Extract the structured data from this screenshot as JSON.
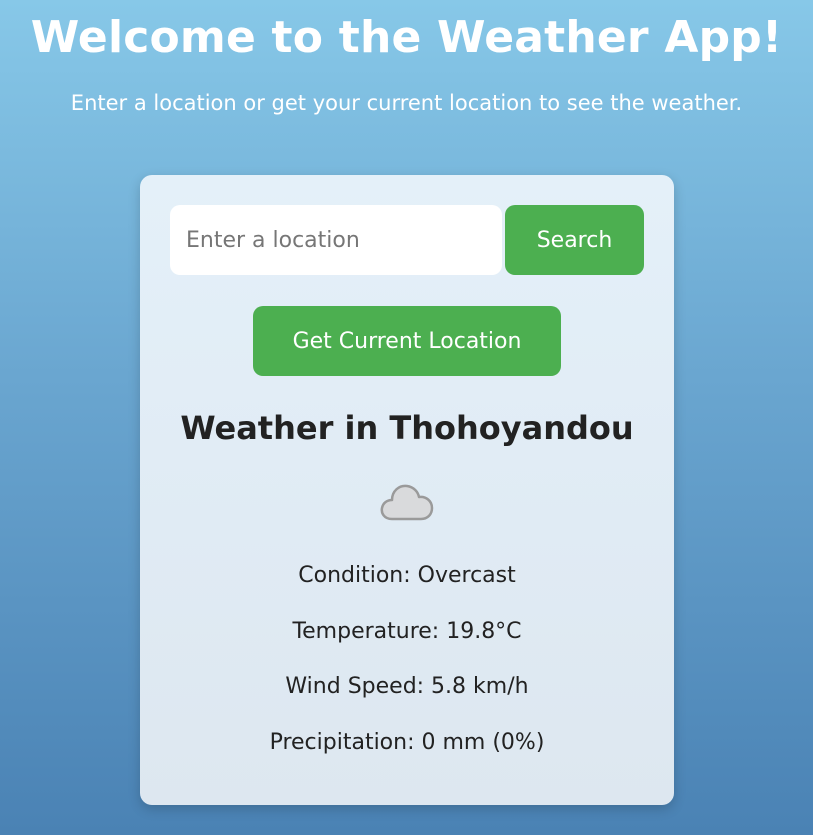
{
  "header": {
    "title": "Welcome to the Weather App!",
    "subtitle": "Enter a location or get your current location to see the weather."
  },
  "search": {
    "placeholder": "Enter a location",
    "value": "",
    "button_label": "Search"
  },
  "location_button_label": "Get Current Location",
  "weather": {
    "title": "Weather in Thohoyandou",
    "icon": "cloud-icon",
    "condition": "Condition: Overcast",
    "temperature": "Temperature: 19.8°C",
    "wind_speed": "Wind Speed: 5.8 km/h",
    "precipitation": "Precipitation: 0 mm (0%)"
  },
  "colors": {
    "button": "#4caf50",
    "background_top": "#87c8e8",
    "background_bottom": "#4a82b4"
  }
}
